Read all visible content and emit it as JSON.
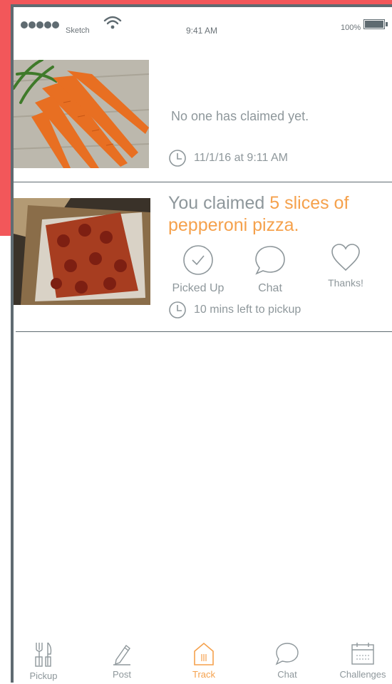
{
  "status_bar": {
    "carrier": "Sketch",
    "time": "9:41 AM",
    "battery": "100%"
  },
  "posts": [
    {
      "image": "carrots-photo",
      "status_text": "No one has claimed yet.",
      "timestamp": "11/1/16 at 9:11 AM"
    },
    {
      "image": "pizza-photo",
      "claim_prefix": "You claimed ",
      "claim_item": "5 slices of pepperoni pizza.",
      "actions": [
        {
          "label": "Picked Up",
          "icon": "check-circle-icon"
        },
        {
          "label": "Chat",
          "icon": "chat-bubble-icon"
        },
        {
          "label": "Thanks!",
          "icon": "heart-icon"
        }
      ],
      "time_left": "10 mins left to pickup"
    }
  ],
  "tabs": [
    {
      "label": "Pickup",
      "icon": "utensils-icon",
      "active": false
    },
    {
      "label": "Post",
      "icon": "pencil-icon",
      "active": false
    },
    {
      "label": "Track",
      "icon": "house-icon",
      "active": true
    },
    {
      "label": "Chat",
      "icon": "chat-bubble-icon",
      "active": false
    },
    {
      "label": "Challenges",
      "icon": "calendar-icon",
      "active": false
    }
  ],
  "colors": {
    "accent": "#f5a14c",
    "background_accent": "#f2575a",
    "text_muted": "#8e979b",
    "frame": "#5f6b71"
  }
}
